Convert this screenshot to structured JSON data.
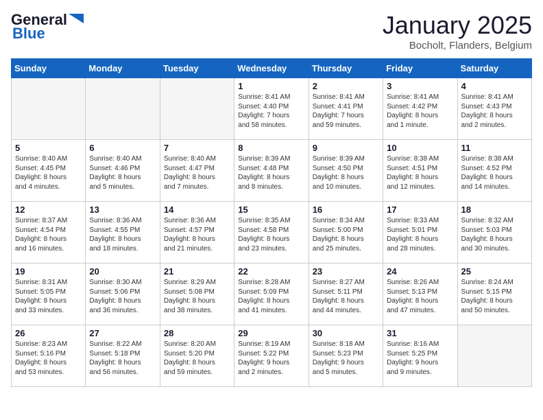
{
  "logo": {
    "general": "General",
    "blue": "Blue"
  },
  "header": {
    "month": "January 2025",
    "location": "Bocholt, Flanders, Belgium"
  },
  "weekdays": [
    "Sunday",
    "Monday",
    "Tuesday",
    "Wednesday",
    "Thursday",
    "Friday",
    "Saturday"
  ],
  "weeks": [
    [
      {
        "day": "",
        "info": ""
      },
      {
        "day": "",
        "info": ""
      },
      {
        "day": "",
        "info": ""
      },
      {
        "day": "1",
        "info": "Sunrise: 8:41 AM\nSunset: 4:40 PM\nDaylight: 7 hours\nand 58 minutes."
      },
      {
        "day": "2",
        "info": "Sunrise: 8:41 AM\nSunset: 4:41 PM\nDaylight: 7 hours\nand 59 minutes."
      },
      {
        "day": "3",
        "info": "Sunrise: 8:41 AM\nSunset: 4:42 PM\nDaylight: 8 hours\nand 1 minute."
      },
      {
        "day": "4",
        "info": "Sunrise: 8:41 AM\nSunset: 4:43 PM\nDaylight: 8 hours\nand 2 minutes."
      }
    ],
    [
      {
        "day": "5",
        "info": "Sunrise: 8:40 AM\nSunset: 4:45 PM\nDaylight: 8 hours\nand 4 minutes."
      },
      {
        "day": "6",
        "info": "Sunrise: 8:40 AM\nSunset: 4:46 PM\nDaylight: 8 hours\nand 5 minutes."
      },
      {
        "day": "7",
        "info": "Sunrise: 8:40 AM\nSunset: 4:47 PM\nDaylight: 8 hours\nand 7 minutes."
      },
      {
        "day": "8",
        "info": "Sunrise: 8:39 AM\nSunset: 4:48 PM\nDaylight: 8 hours\nand 8 minutes."
      },
      {
        "day": "9",
        "info": "Sunrise: 8:39 AM\nSunset: 4:50 PM\nDaylight: 8 hours\nand 10 minutes."
      },
      {
        "day": "10",
        "info": "Sunrise: 8:38 AM\nSunset: 4:51 PM\nDaylight: 8 hours\nand 12 minutes."
      },
      {
        "day": "11",
        "info": "Sunrise: 8:38 AM\nSunset: 4:52 PM\nDaylight: 8 hours\nand 14 minutes."
      }
    ],
    [
      {
        "day": "12",
        "info": "Sunrise: 8:37 AM\nSunset: 4:54 PM\nDaylight: 8 hours\nand 16 minutes."
      },
      {
        "day": "13",
        "info": "Sunrise: 8:36 AM\nSunset: 4:55 PM\nDaylight: 8 hours\nand 18 minutes."
      },
      {
        "day": "14",
        "info": "Sunrise: 8:36 AM\nSunset: 4:57 PM\nDaylight: 8 hours\nand 21 minutes."
      },
      {
        "day": "15",
        "info": "Sunrise: 8:35 AM\nSunset: 4:58 PM\nDaylight: 8 hours\nand 23 minutes."
      },
      {
        "day": "16",
        "info": "Sunrise: 8:34 AM\nSunset: 5:00 PM\nDaylight: 8 hours\nand 25 minutes."
      },
      {
        "day": "17",
        "info": "Sunrise: 8:33 AM\nSunset: 5:01 PM\nDaylight: 8 hours\nand 28 minutes."
      },
      {
        "day": "18",
        "info": "Sunrise: 8:32 AM\nSunset: 5:03 PM\nDaylight: 8 hours\nand 30 minutes."
      }
    ],
    [
      {
        "day": "19",
        "info": "Sunrise: 8:31 AM\nSunset: 5:05 PM\nDaylight: 8 hours\nand 33 minutes."
      },
      {
        "day": "20",
        "info": "Sunrise: 8:30 AM\nSunset: 5:06 PM\nDaylight: 8 hours\nand 36 minutes."
      },
      {
        "day": "21",
        "info": "Sunrise: 8:29 AM\nSunset: 5:08 PM\nDaylight: 8 hours\nand 38 minutes."
      },
      {
        "day": "22",
        "info": "Sunrise: 8:28 AM\nSunset: 5:09 PM\nDaylight: 8 hours\nand 41 minutes."
      },
      {
        "day": "23",
        "info": "Sunrise: 8:27 AM\nSunset: 5:11 PM\nDaylight: 8 hours\nand 44 minutes."
      },
      {
        "day": "24",
        "info": "Sunrise: 8:26 AM\nSunset: 5:13 PM\nDaylight: 8 hours\nand 47 minutes."
      },
      {
        "day": "25",
        "info": "Sunrise: 8:24 AM\nSunset: 5:15 PM\nDaylight: 8 hours\nand 50 minutes."
      }
    ],
    [
      {
        "day": "26",
        "info": "Sunrise: 8:23 AM\nSunset: 5:16 PM\nDaylight: 8 hours\nand 53 minutes."
      },
      {
        "day": "27",
        "info": "Sunrise: 8:22 AM\nSunset: 5:18 PM\nDaylight: 8 hours\nand 56 minutes."
      },
      {
        "day": "28",
        "info": "Sunrise: 8:20 AM\nSunset: 5:20 PM\nDaylight: 8 hours\nand 59 minutes."
      },
      {
        "day": "29",
        "info": "Sunrise: 8:19 AM\nSunset: 5:22 PM\nDaylight: 9 hours\nand 2 minutes."
      },
      {
        "day": "30",
        "info": "Sunrise: 8:18 AM\nSunset: 5:23 PM\nDaylight: 9 hours\nand 5 minutes."
      },
      {
        "day": "31",
        "info": "Sunrise: 8:16 AM\nSunset: 5:25 PM\nDaylight: 9 hours\nand 9 minutes."
      },
      {
        "day": "",
        "info": ""
      }
    ]
  ]
}
